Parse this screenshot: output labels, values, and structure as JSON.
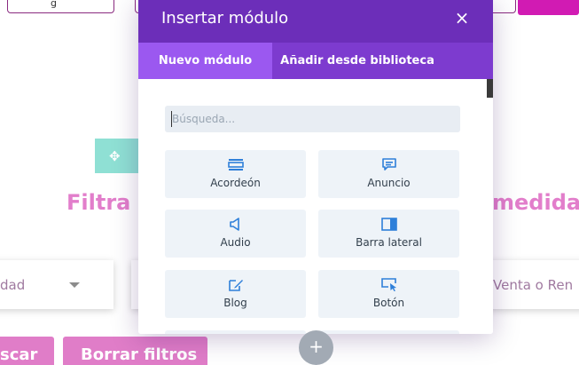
{
  "background": {
    "top_input_text": "g",
    "heading_left": "Filtra y",
    "heading_right": "medida",
    "select_left_text": "dad",
    "select_right_text": "Venta o Ren",
    "btn_search_label": "scar",
    "btn_clear_label": "Borrar filtros",
    "accent_pink": "#e27ecb",
    "accent_teal": "#8fe0d4"
  },
  "modal": {
    "title": "Insertar módulo",
    "close_label": "×",
    "tabs": [
      {
        "label": "Nuevo módulo",
        "active": true
      },
      {
        "label": "Añadir desde biblioteca",
        "active": false
      }
    ],
    "search": {
      "placeholder": "Búsqueda...",
      "value": ""
    },
    "modules": [
      {
        "label": "Acordeón",
        "icon": "accordion-icon"
      },
      {
        "label": "Anuncio",
        "icon": "announcement-icon"
      },
      {
        "label": "Audio",
        "icon": "audio-icon"
      },
      {
        "label": "Barra lateral",
        "icon": "sidebar-icon"
      },
      {
        "label": "Blog",
        "icon": "blog-icon"
      },
      {
        "label": "Botón",
        "icon": "button-icon"
      }
    ],
    "colors": {
      "header": "#6c2eb9",
      "tabs": "#7d3bcf",
      "active_tab": "#9b58f0",
      "icon_blue": "#2e7fd9"
    }
  },
  "fab_label": "+"
}
